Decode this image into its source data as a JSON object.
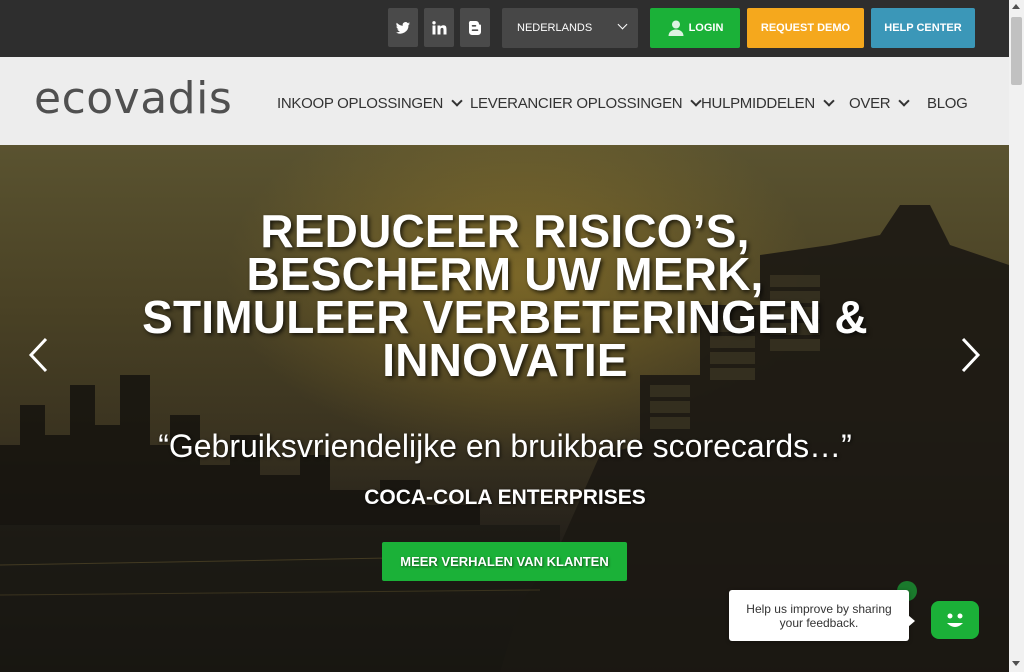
{
  "topbar": {
    "social": [
      {
        "name": "twitter-icon"
      },
      {
        "name": "linkedin-icon"
      },
      {
        "name": "blogger-icon"
      }
    ],
    "language": "NEDERLANDS",
    "login": "LOGIN",
    "request_demo": "REQUEST DEMO",
    "help_center": "HELP CENTER"
  },
  "nav": {
    "logo": "ecovadis",
    "items": [
      {
        "label": "INKOOP OPLOSSINGEN",
        "dropdown": true
      },
      {
        "label": "LEVERANCIER OPLOSSINGEN",
        "dropdown": true
      },
      {
        "label": "HULPMIDDELEN",
        "dropdown": true
      },
      {
        "label": "OVER",
        "dropdown": true
      },
      {
        "label": "BLOG",
        "dropdown": false
      }
    ]
  },
  "hero": {
    "headline_lines": [
      "REDUCEER RISICO’S,",
      "BESCHERM UW MERK,",
      "STIMULEER VERBETERINGEN &",
      "INNOVATIE"
    ],
    "quote": "“Gebruiksvriendelijke en bruikbare scorecards…”",
    "company": "COCA-COLA ENTERPRISES",
    "cta": "MEER VERHALEN VAN KLANTEN"
  },
  "feedback": {
    "text": "Help us improve by sharing your feedback."
  },
  "colors": {
    "green": "#1bb138",
    "orange": "#f5a81d",
    "blue": "#3b97b8",
    "topbar": "#2e2e2e",
    "navbar": "#ededed"
  }
}
